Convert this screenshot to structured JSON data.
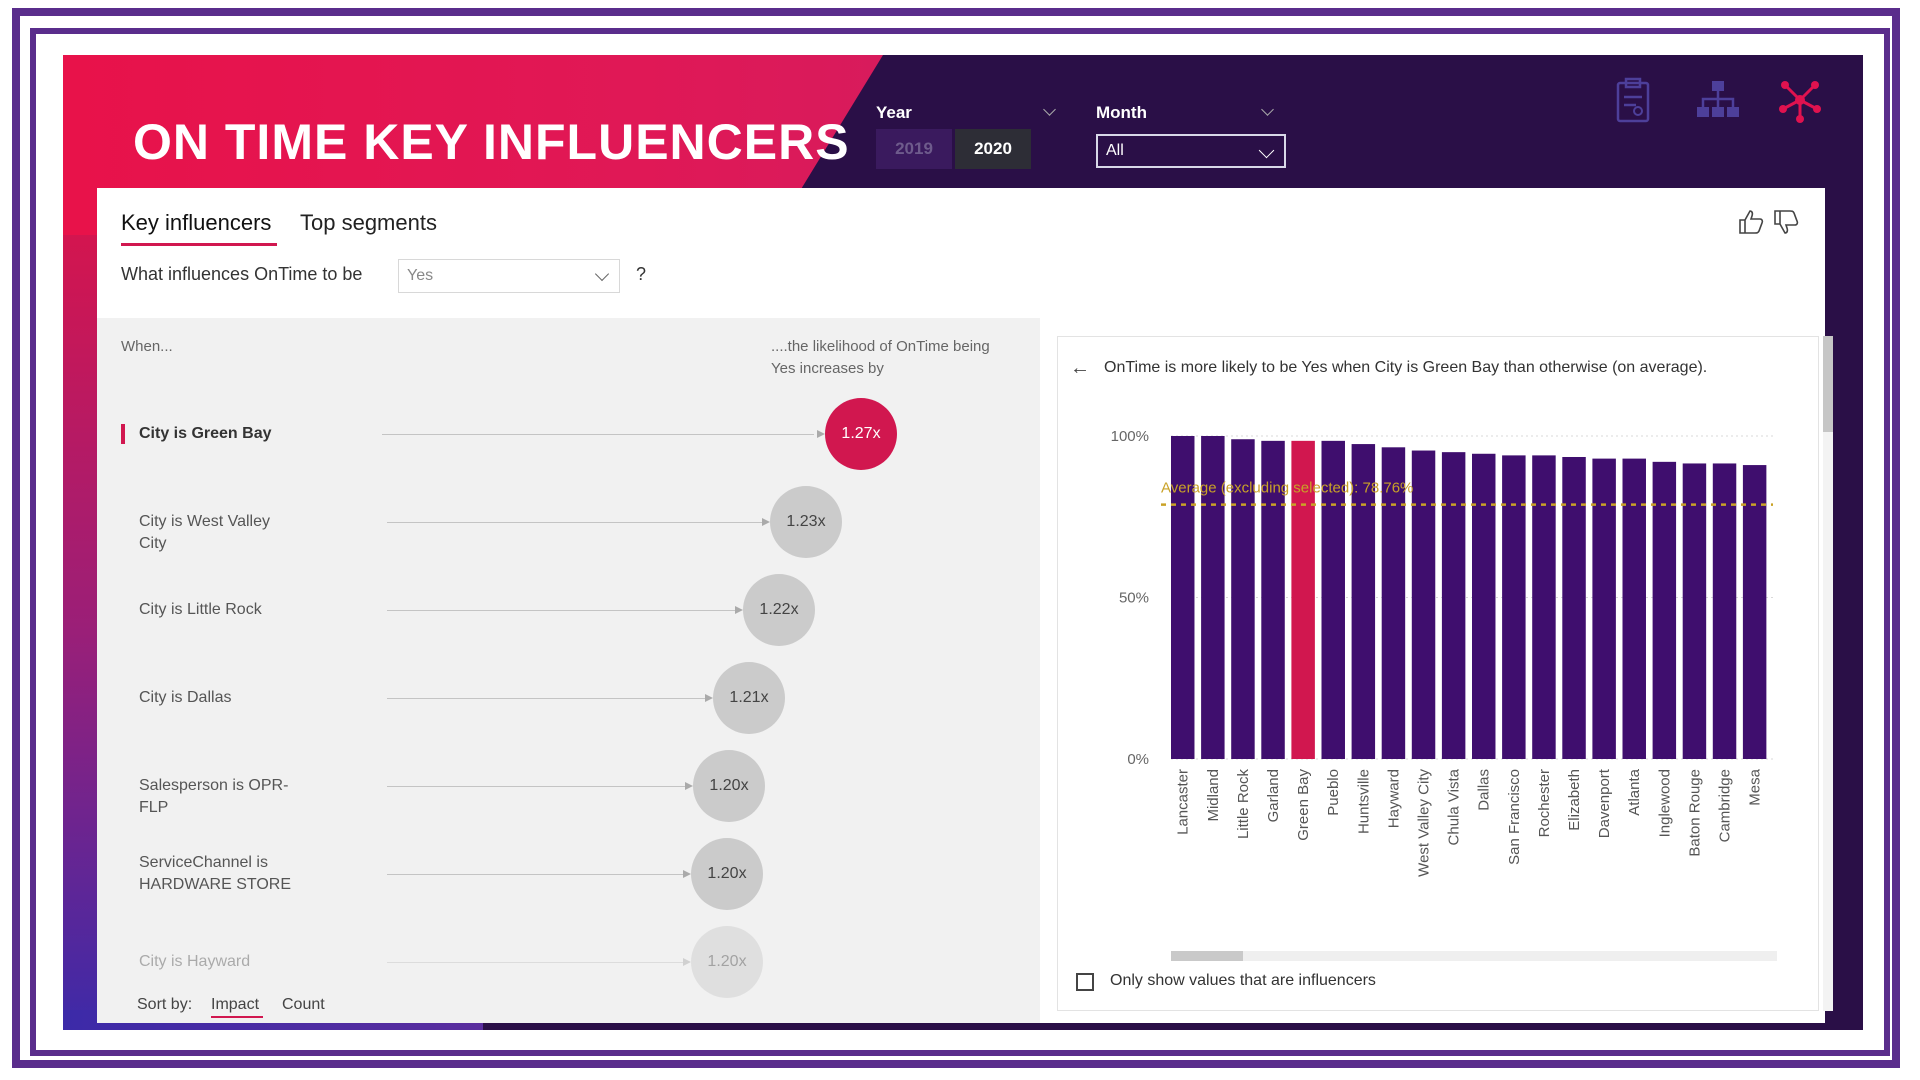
{
  "report": {
    "title": "ON TIME KEY INFLUENCERS"
  },
  "slicers": {
    "year": {
      "label": "Year",
      "options": [
        "2019",
        "2020"
      ],
      "selected": "2020"
    },
    "month": {
      "label": "Month",
      "value": "All"
    }
  },
  "top_icons": [
    "clipboard-icon",
    "hierarchy-icon",
    "network-icon"
  ],
  "visual": {
    "tabs": [
      "Key influencers",
      "Top segments"
    ],
    "active_tab": "Key influencers",
    "question": "What influences OnTime to be",
    "selected_value": "Yes",
    "question_mark": "?",
    "when_label": "When...",
    "likelihood_label": "....the likelihood of OnTime being Yes increases by",
    "influencers": [
      {
        "label": "City is Green Bay",
        "value": "1.27x",
        "selected": true
      },
      {
        "label": "City is West Valley City",
        "value": "1.23x"
      },
      {
        "label": "City is Little Rock",
        "value": "1.22x"
      },
      {
        "label": "City is Dallas",
        "value": "1.21x"
      },
      {
        "label": "Salesperson is OPR-FLP",
        "value": "1.20x"
      },
      {
        "label": "ServiceChannel is HARDWARE STORE",
        "value": "1.20x"
      },
      {
        "label": "City is Hayward",
        "value": "1.20x"
      }
    ],
    "sort": {
      "label": "Sort by:",
      "options": [
        "Impact",
        "Count"
      ],
      "selected": "Impact"
    },
    "explanation": "OnTime is more likely to be Yes when City is Green Bay than otherwise (on average).",
    "checkbox_label": "Only show values that are influencers"
  },
  "colors": {
    "accent": "#d1174f",
    "bar": "#3f0e6e",
    "header_dark": "#2a0f47",
    "average_line": "#c9a227"
  },
  "chart_data": {
    "type": "bar",
    "categories": [
      "Lancaster",
      "Midland",
      "Little Rock",
      "Garland",
      "Green Bay",
      "Pueblo",
      "Huntsville",
      "Hayward",
      "West Valley City",
      "Chula Vista",
      "Dallas",
      "San Francisco",
      "Rochester",
      "Elizabeth",
      "Davenport",
      "Atlanta",
      "Inglewood",
      "Baton Rouge",
      "Cambridge",
      "Mesa"
    ],
    "values": [
      100,
      100,
      99,
      98.5,
      98.5,
      98.5,
      97.5,
      96.5,
      95.5,
      95,
      94.5,
      94,
      94,
      93.5,
      93,
      93,
      92,
      91.5,
      91.5,
      91
    ],
    "highlighted": "Green Bay",
    "average": {
      "label": "Average (excluding selected): 78.76%",
      "value": 78.76
    },
    "ytick_labels": [
      "100%",
      "50%",
      "0%"
    ],
    "ylim": [
      0,
      100
    ]
  }
}
